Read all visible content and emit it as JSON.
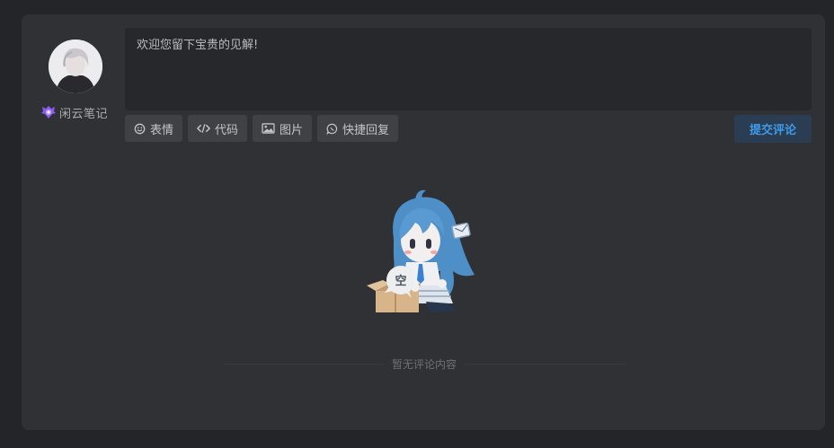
{
  "comment_form": {
    "user_name": "闲云笔记",
    "placeholder": "欢迎您留下宝贵的见解!",
    "submit_label": "提交评论",
    "tools": [
      {
        "label": "表情",
        "icon": "smiley-icon"
      },
      {
        "label": "代码",
        "icon": "code-icon"
      },
      {
        "label": "图片",
        "icon": "image-icon"
      },
      {
        "label": "快捷回复",
        "icon": "chat-bubble-icon"
      }
    ]
  },
  "empty_state": {
    "bubble_text": "空",
    "message": "暂无评论内容"
  },
  "colors": {
    "background": "#242529",
    "panel": "#303134",
    "input": "#27282c",
    "tool_button": "#404145",
    "submit_bg": "#2b3d52",
    "submit_text": "#3f9ae8"
  }
}
